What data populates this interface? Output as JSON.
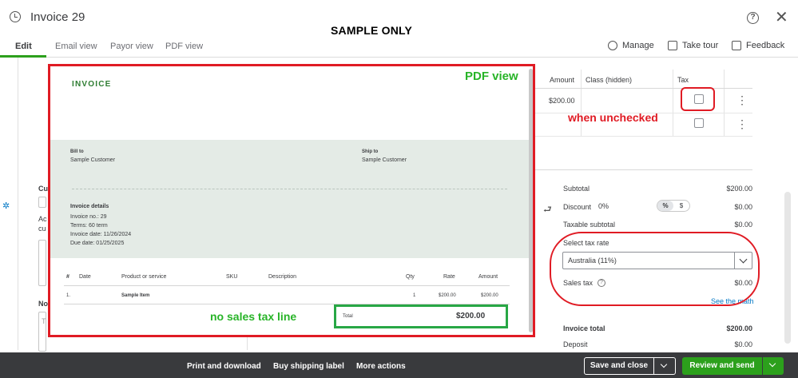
{
  "header": {
    "title": "Invoice 29",
    "banner": "SAMPLE ONLY",
    "help_glyph": "?",
    "close_glyph": "✕"
  },
  "tabs": [
    {
      "label": "Edit",
      "active": true
    },
    {
      "label": "Email view"
    },
    {
      "label": "Payor view"
    },
    {
      "label": "PDF view"
    }
  ],
  "toolbar": {
    "manage": "Manage",
    "take_tour": "Take tour",
    "feedback": "Feedback"
  },
  "line_table": {
    "headers": {
      "amount": "Amount",
      "class": "Class (hidden)",
      "tax": "Tax"
    },
    "rows": [
      {
        "amount": "$200.00",
        "tax_checked": false
      },
      {
        "amount": "",
        "tax_checked": false
      }
    ],
    "kebab": "⋮"
  },
  "summary": {
    "subtotal_label": "Subtotal",
    "subtotal_value": "$200.00",
    "discount_label": "Discount",
    "discount_pct": "0%",
    "discount_toggle": [
      "%",
      "$"
    ],
    "discount_value": "$0.00",
    "taxable_label": "Taxable subtotal",
    "taxable_value": "$0.00",
    "tax_rate_label": "Select tax rate",
    "tax_rate_value": "Australia (11%)",
    "sales_tax_label": "Sales tax",
    "sales_tax_info": "?",
    "sales_tax_value": "$0.00",
    "see_math": "See the math",
    "invoice_total_label": "Invoice total",
    "invoice_total_value": "$200.00",
    "deposit_label": "Deposit",
    "deposit_value": "$0.00"
  },
  "left_fragments": {
    "cu": "Cu",
    "ac": "Ac",
    "cu2": "cu",
    "no": "No",
    "t": "T"
  },
  "pdf": {
    "title": "INVOICE",
    "bill_to_label": "Bill to",
    "bill_to": "Sample Customer",
    "ship_to_label": "Ship to",
    "ship_to": "Sample Customer",
    "details_label": "Invoice details",
    "invoice_no": "Invoice no.: 29",
    "terms": "Terms: 60 term",
    "invoice_date": "Invoice date: 11/26/2024",
    "due_date": "Due date: 01/25/2025",
    "columns": {
      "num": "#",
      "date": "Date",
      "product": "Product or service",
      "sku": "SKU",
      "desc": "Description",
      "qty": "Qty",
      "rate": "Rate",
      "amount": "Amount"
    },
    "row": {
      "num": "1.",
      "product": "Sample Item",
      "qty": "1",
      "rate": "$200.00",
      "amount": "$200.00"
    },
    "total_label": "Total",
    "total_value": "$200.00"
  },
  "annotations": {
    "pdf_view": "PDF view",
    "when_unchecked": "when unchecked",
    "no_sales_tax": "no sales tax line"
  },
  "footer": {
    "print": "Print and download",
    "shipping": "Buy shipping label",
    "more": "More actions",
    "save_close": "Save and close",
    "review_send": "Review and send"
  },
  "colors": {
    "brand_green": "#2ca01c",
    "annotation_red": "#e01b24",
    "annotation_green": "#28b428",
    "footer_bg": "#393a3d",
    "link_blue": "#0077c5"
  }
}
